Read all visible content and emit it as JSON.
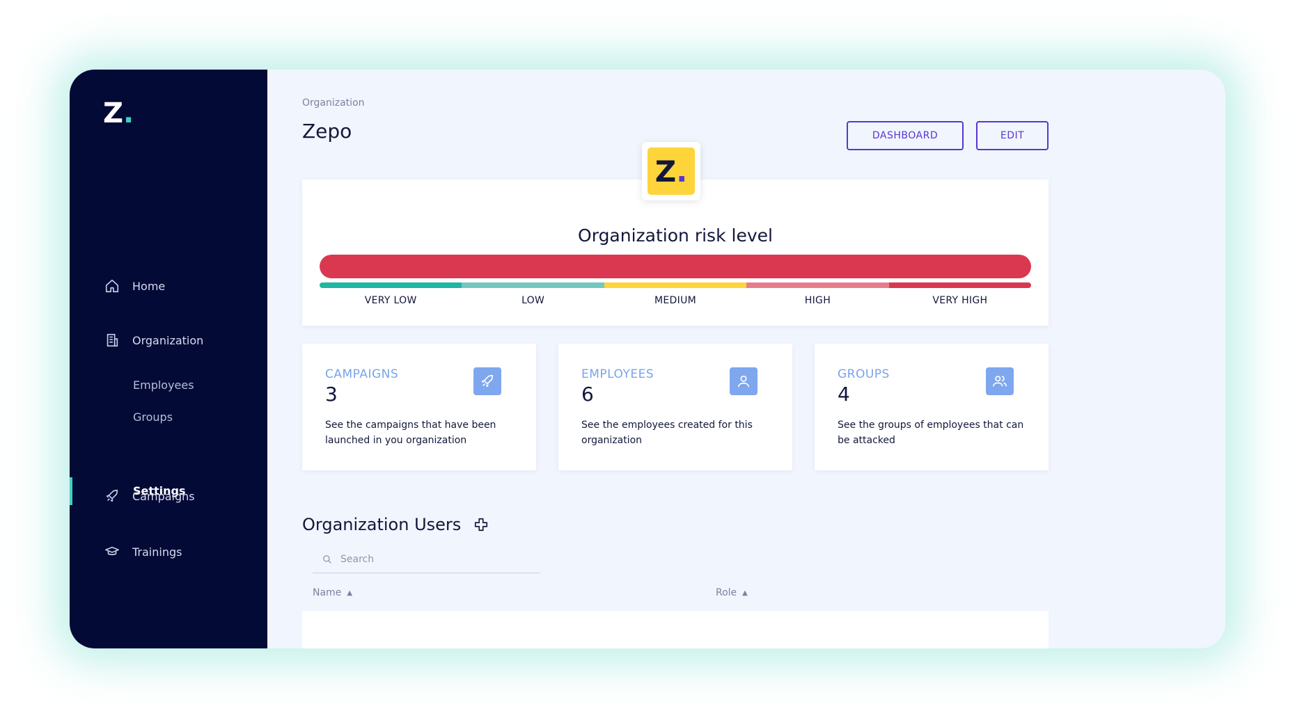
{
  "sidebar": {
    "logo_letter": "Z",
    "logo_dot": ".",
    "nav": [
      {
        "label": "Home",
        "icon": "home-icon"
      },
      {
        "label": "Organization",
        "icon": "building-icon"
      },
      {
        "label": "Campaigns",
        "icon": "rocket-icon"
      },
      {
        "label": "Trainings",
        "icon": "graduation-cap-icon"
      }
    ],
    "sub_items": [
      {
        "label": "Employees"
      },
      {
        "label": "Groups"
      },
      {
        "label": "Settings",
        "active": true
      }
    ]
  },
  "header": {
    "breadcrumb": "Organization",
    "title": "Zepo",
    "dashboard_button": "DASHBOARD",
    "edit_button": "EDIT"
  },
  "org_logo": {
    "letter": "Z",
    "dot": "."
  },
  "risk": {
    "title": "Organization risk level",
    "level_fraction": 1.0,
    "level_label": "VERY HIGH",
    "scale": [
      {
        "label": "VERY LOW",
        "color": "#1fb6a2"
      },
      {
        "label": "LOW",
        "color": "#74c7bf"
      },
      {
        "label": "MEDIUM",
        "color": "#fdd43a"
      },
      {
        "label": "HIGH",
        "color": "#e77d8c"
      },
      {
        "label": "VERY HIGH",
        "color": "#d93850"
      }
    ]
  },
  "stats": [
    {
      "label": "CAMPAIGNS",
      "value": "3",
      "desc": "See the campaigns that have been launched in you organization",
      "icon": "rocket-icon"
    },
    {
      "label": "EMPLOYEES",
      "value": "6",
      "desc": "See the employees created for this organization",
      "icon": "user-icon"
    },
    {
      "label": "GROUPS",
      "value": "4",
      "desc": "See the groups of employees that can be attacked",
      "icon": "users-icon"
    }
  ],
  "users": {
    "title": "Organization Users",
    "search_placeholder": "Search",
    "columns": [
      {
        "label": "Name"
      },
      {
        "label": "Role"
      }
    ]
  },
  "colors": {
    "sidebar_bg": "#040a36",
    "accent": "#5636d3",
    "teal": "#3fd1c0",
    "stat_label": "#7aa4ea",
    "risk_fill": "#d93850"
  }
}
